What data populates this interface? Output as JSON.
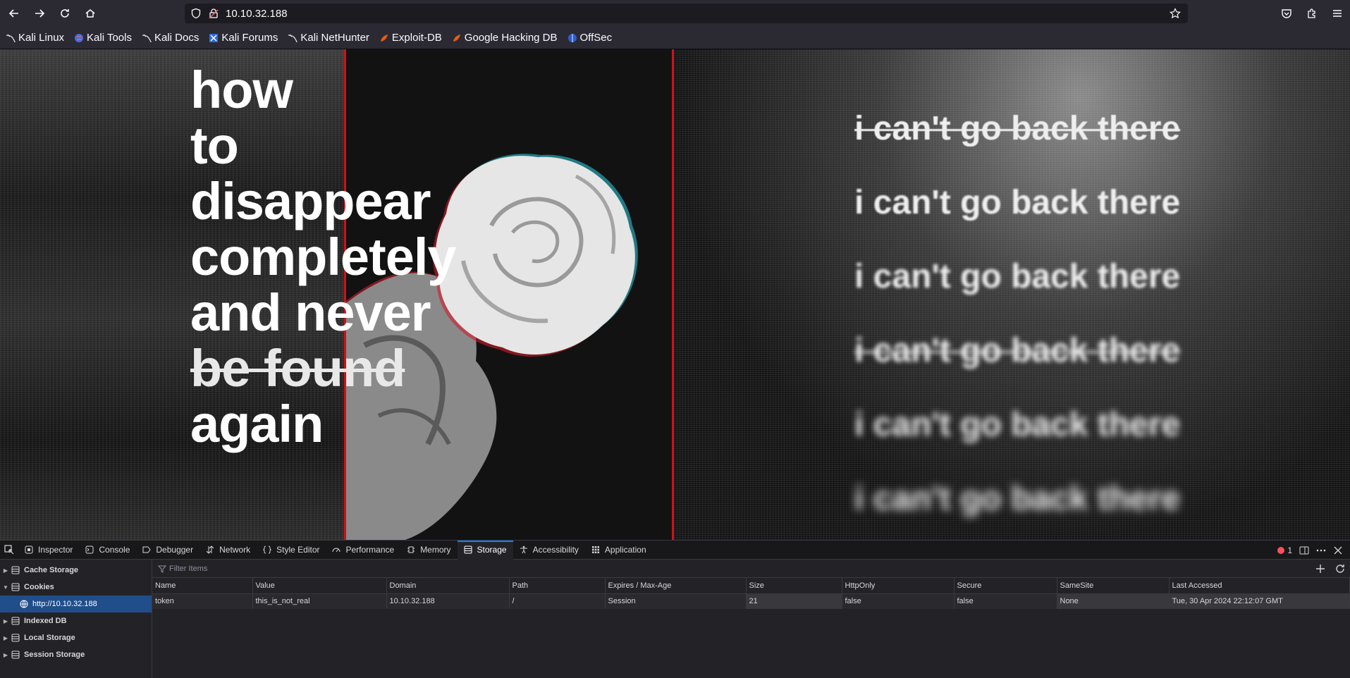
{
  "browser": {
    "url": "10.10.32.188",
    "bookmarks": [
      {
        "label": "Kali Linux",
        "icon": "kali-dragon-icon"
      },
      {
        "label": "Kali Tools",
        "icon": "kali-tools-icon"
      },
      {
        "label": "Kali Docs",
        "icon": "kali-dragon-icon"
      },
      {
        "label": "Kali Forums",
        "icon": "kali-forums-icon"
      },
      {
        "label": "Kali NetHunter",
        "icon": "kali-dragon-icon"
      },
      {
        "label": "Exploit-DB",
        "icon": "exploit-db-icon"
      },
      {
        "label": "Google Hacking DB",
        "icon": "exploit-db-icon"
      },
      {
        "label": "OffSec",
        "icon": "offsec-icon"
      }
    ]
  },
  "page": {
    "poem": [
      "how",
      "to",
      "disappear",
      "completely",
      "and never",
      "be found",
      "again"
    ],
    "phrase": "i can't go back there"
  },
  "devtools": {
    "tabs": [
      {
        "label": "Inspector",
        "icon": "inspector-icon"
      },
      {
        "label": "Console",
        "icon": "console-icon"
      },
      {
        "label": "Debugger",
        "icon": "debugger-icon"
      },
      {
        "label": "Network",
        "icon": "network-icon"
      },
      {
        "label": "Style Editor",
        "icon": "style-editor-icon"
      },
      {
        "label": "Performance",
        "icon": "performance-icon"
      },
      {
        "label": "Memory",
        "icon": "memory-icon"
      },
      {
        "label": "Storage",
        "icon": "storage-icon",
        "active": true
      },
      {
        "label": "Accessibility",
        "icon": "accessibility-icon"
      },
      {
        "label": "Application",
        "icon": "application-icon"
      }
    ],
    "error_count": "1",
    "tree": {
      "cache_storage": "Cache Storage",
      "cookies": "Cookies",
      "cookie_host": "http://10.10.32.188",
      "indexed_db": "Indexed DB",
      "local_storage": "Local Storage",
      "session_storage": "Session Storage"
    },
    "filter_placeholder": "Filter Items",
    "columns": [
      "Name",
      "Value",
      "Domain",
      "Path",
      "Expires / Max-Age",
      "Size",
      "HttpOnly",
      "Secure",
      "SameSite",
      "Last Accessed"
    ],
    "rows": [
      [
        "token",
        "this_is_not_real",
        "10.10.32.188",
        "/",
        "Session",
        "21",
        "false",
        "false",
        "None",
        "Tue, 30 Apr 2024 22:12:07 GMT"
      ]
    ]
  },
  "colors": {
    "accent": "#0a84ff",
    "panel_border": "#d0101a",
    "selection": "#204e8a"
  }
}
